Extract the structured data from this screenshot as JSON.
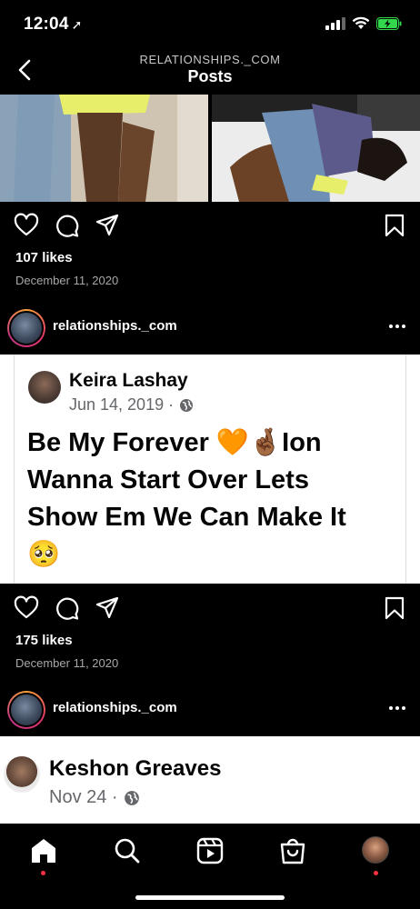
{
  "status_bar": {
    "time": "12:04",
    "battery_color": "#32d74b"
  },
  "header": {
    "account": "RELATIONSHIPS._COM",
    "title": "Posts"
  },
  "posts": [
    {
      "likes": "107 likes",
      "date": "December 11, 2020"
    },
    {
      "username": "relationships._com",
      "fb_name": "Keira Lashay",
      "fb_date": "Jun 14, 2019 ·",
      "fb_text_line1": "Be My Forever 🧡🤞🏾Ion",
      "fb_text_line2": "Wanna Start Over Lets",
      "fb_text_line3": "Show Em We Can Make It",
      "fb_text_line4": "🥺",
      "likes": "175 likes",
      "date": "December 11, 2020"
    },
    {
      "username": "relationships._com",
      "fb_name": "Keshon Greaves",
      "fb_date": "Nov 24 ·"
    }
  ],
  "icons": {
    "like": "heart-icon",
    "comment": "comment-icon",
    "share": "send-icon",
    "save": "bookmark-icon",
    "more": "more-options-icon"
  },
  "nav": {
    "items": [
      "home",
      "search",
      "reels",
      "shop",
      "profile"
    ],
    "notification_color": "#ff3040"
  }
}
